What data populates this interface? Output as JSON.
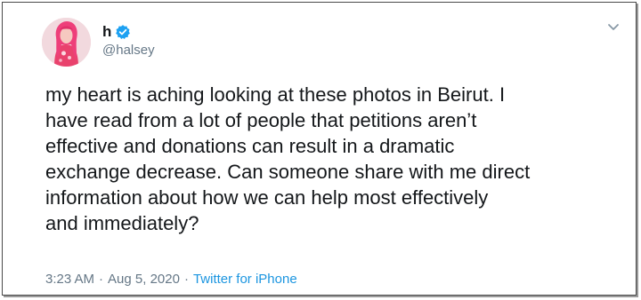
{
  "tweet": {
    "display_name": "h",
    "handle": "@halsey",
    "verified": true,
    "verified_icon": "verified-badge-icon",
    "menu_icon": "chevron-down-icon",
    "text": "my heart is aching looking at these photos in Beirut. I\nhave read from a lot of people that petitions aren’t\neffective and donations can result in a dramatic\nexchange decrease. Can someone share with me direct\ninformation about how we can help most effectively\nand immediately?",
    "time": "3:23 AM",
    "separator": "·",
    "date": "Aug 5, 2020",
    "source": "Twitter for iPhone"
  },
  "colors": {
    "text": "#14171a",
    "secondary": "#657786",
    "accent": "#1b95e0",
    "verified": "#1da1f2"
  }
}
